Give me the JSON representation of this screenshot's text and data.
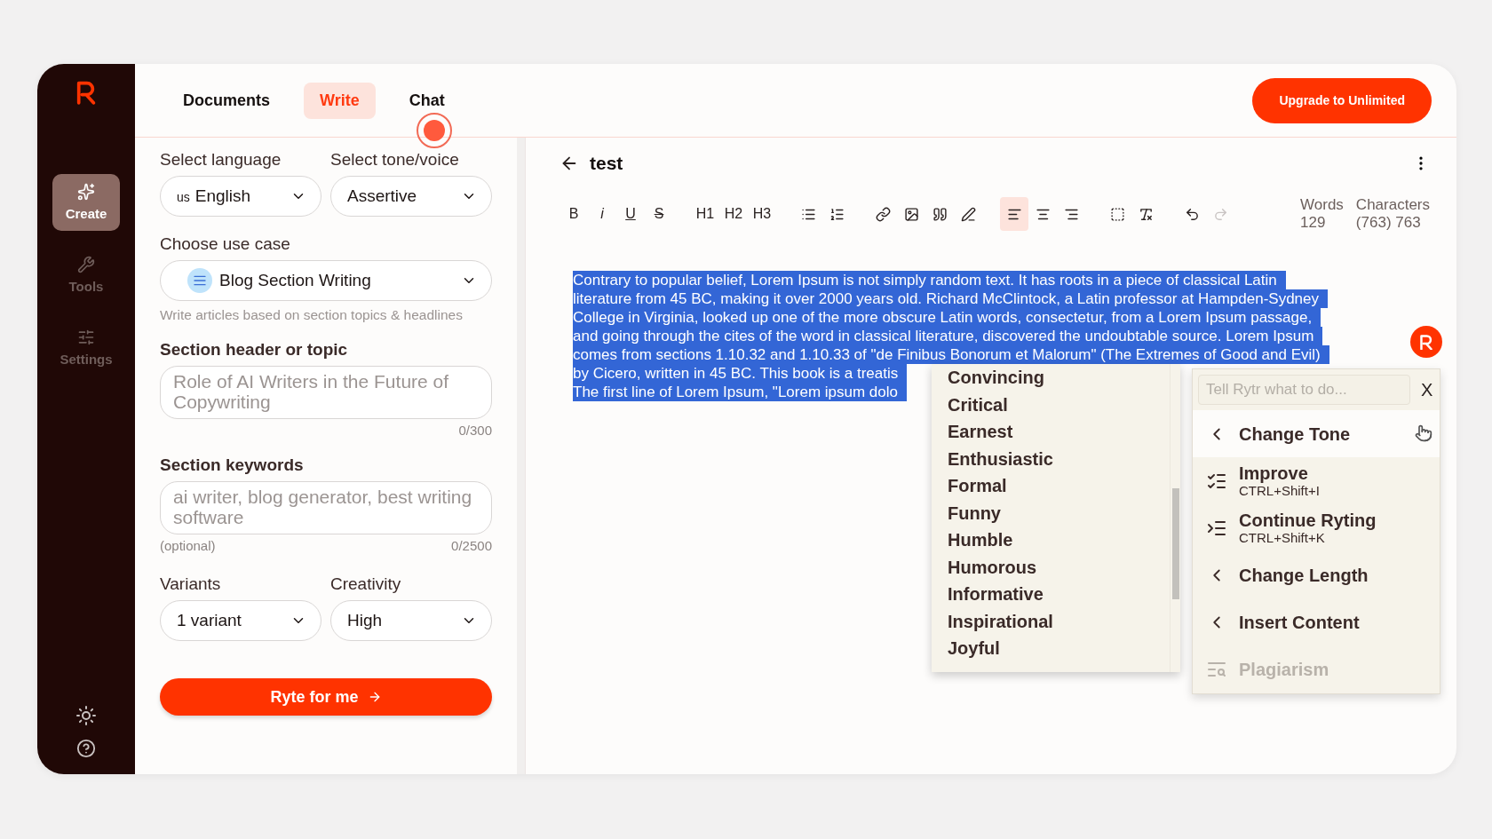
{
  "sidebar": {
    "items": [
      {
        "label": "Create",
        "selected": true
      },
      {
        "label": "Tools",
        "selected": false
      },
      {
        "label": "Settings",
        "selected": false
      }
    ]
  },
  "tabs": [
    {
      "label": "Documents",
      "selected": false
    },
    {
      "label": "Write",
      "selected": true
    },
    {
      "label": "Chat",
      "selected": false
    }
  ],
  "upgrade_button": "Upgrade to Unlimited",
  "form": {
    "language": {
      "label": "Select language",
      "flag": "us",
      "value": "English"
    },
    "tone": {
      "label": "Select tone/voice",
      "value": "Assertive"
    },
    "use_case": {
      "label": "Choose use case",
      "value": "Blog Section Writing",
      "hint": "Write articles based on section topics & headlines"
    },
    "section_header": {
      "label": "Section header or topic",
      "placeholder": "Role of AI Writers in the Future of Copywriting",
      "counter": "0/300"
    },
    "keywords": {
      "label": "Section keywords",
      "placeholder": "ai writer, blog generator, best writing software",
      "note": "(optional)",
      "counter": "0/2500"
    },
    "variants": {
      "label": "Variants",
      "value": "1 variant"
    },
    "creativity": {
      "label": "Creativity",
      "value": "High"
    },
    "submit_button": "Ryte for me"
  },
  "editor": {
    "title": "test",
    "toolbar_groups": [
      {
        "items": [
          {
            "kind": "text",
            "label": "B"
          },
          {
            "kind": "text",
            "label": "i"
          },
          {
            "kind": "text",
            "label": "U"
          },
          {
            "kind": "text",
            "label": "S"
          }
        ]
      },
      {
        "items": [
          {
            "kind": "text",
            "label": "H1"
          },
          {
            "kind": "text",
            "label": "H2"
          },
          {
            "kind": "text",
            "label": "H3"
          }
        ]
      },
      {
        "items": [
          {
            "kind": "icon"
          },
          {
            "kind": "icon"
          }
        ]
      },
      {
        "items": [
          {
            "kind": "icon"
          },
          {
            "kind": "icon"
          },
          {
            "kind": "icon"
          },
          {
            "kind": "icon"
          }
        ]
      },
      {
        "items": [
          {
            "kind": "icon",
            "selected": true
          },
          {
            "kind": "icon",
            "selected": false
          },
          {
            "kind": "icon",
            "selected": false
          }
        ]
      },
      {
        "items": [
          {
            "kind": "icon"
          },
          {
            "kind": "icon"
          }
        ]
      },
      {
        "items": [
          {
            "kind": "icon",
            "disabled": false
          },
          {
            "kind": "icon",
            "disabled": true
          }
        ]
      }
    ],
    "stats": [
      {
        "label": "Words",
        "value": "129"
      },
      {
        "label": "Characters",
        "value": "(763) 763"
      }
    ],
    "selected_lines": [
      "Contrary to popular belief, Lorem Ipsum is not simply random text. It has roots in a piece of classical Latin",
      "literature from 45 BC, making it over 2000 years old. Richard McClintock, a Latin professor at Hampden-Sydney",
      "College in Virginia, looked up one of the more obscure Latin words, consectetur, from a Lorem Ipsum passage,",
      "and going through the cites of the word in classical literature, discovered the undoubtable source. Lorem Ipsum",
      "comes from sections 1.10.32 and 1.10.33 of \"de Finibus Bonorum et Malorum\" (The Extremes of Good and Evil)",
      "by Cicero, written in 45 BC. This book is a treatis",
      "The first line of Lorem Ipsum, \"Lorem ipsum dolo"
    ]
  },
  "tone_menu": {
    "items": [
      "Convincing",
      "Critical",
      "Earnest",
      "Enthusiastic",
      "Formal",
      "Funny",
      "Humble",
      "Humorous",
      "Informative",
      "Inspirational",
      "Joyful"
    ]
  },
  "action_menu": {
    "placeholder": "Tell Rytr what to do...",
    "close": "X",
    "items": [
      {
        "kind": "submenu",
        "label": "Change Tone",
        "highlighted": true,
        "disabled": false
      },
      {
        "kind": "command",
        "label": "Improve",
        "shortcut": "CTRL+Shift+I",
        "highlighted": false,
        "disabled": false
      },
      {
        "kind": "command",
        "label": "Continue Ryting",
        "shortcut": "CTRL+Shift+K",
        "highlighted": false,
        "disabled": false
      },
      {
        "kind": "submenu",
        "label": "Change Length",
        "highlighted": false,
        "disabled": false
      },
      {
        "kind": "submenu",
        "label": "Insert Content",
        "highlighted": false,
        "disabled": false
      },
      {
        "kind": "command",
        "label": "Plagiarism",
        "highlighted": false,
        "disabled": true
      }
    ]
  }
}
